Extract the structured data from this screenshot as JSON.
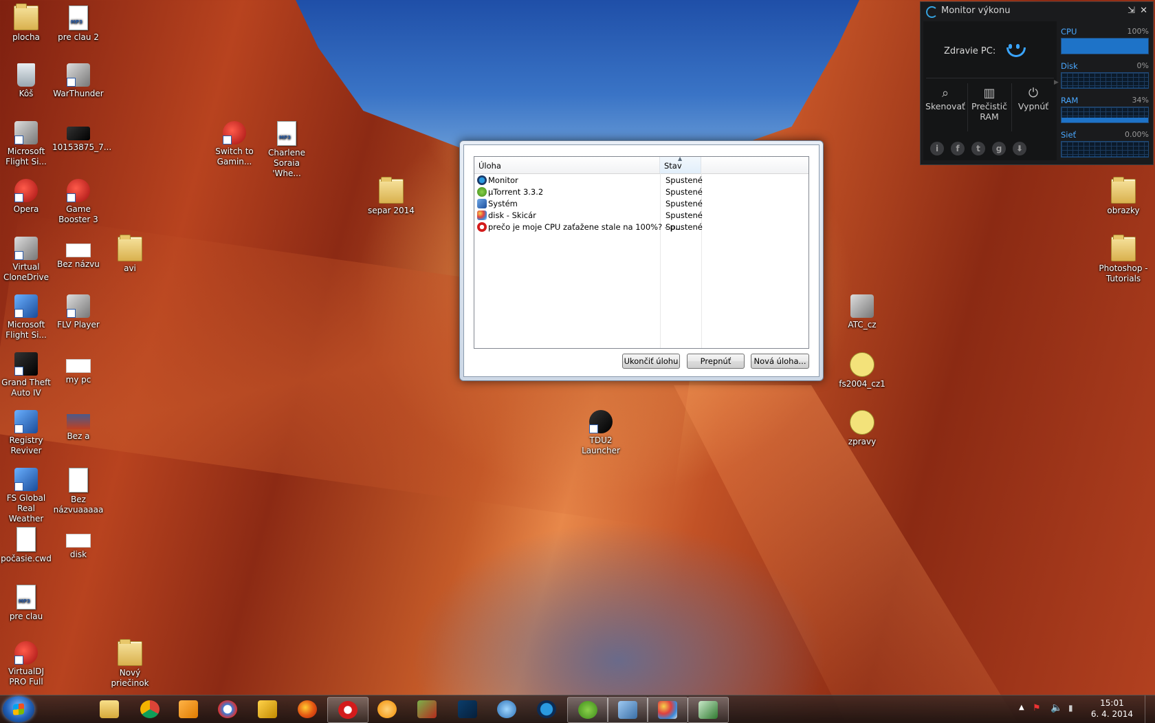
{
  "desktop": {
    "icons": [
      {
        "label": "plocha"
      },
      {
        "label": "pre clau 2"
      },
      {
        "label": "Kôš"
      },
      {
        "label": "WarThunder"
      },
      {
        "label": "Microsoft Flight Si..."
      },
      {
        "label": "10153875_7..."
      },
      {
        "label": "Switch to Gamin..."
      },
      {
        "label": "Charlene Soraia 'Whe..."
      },
      {
        "label": "Opera"
      },
      {
        "label": "Game Booster 3"
      },
      {
        "label": "separ 2014"
      },
      {
        "label": "Virtual CloneDrive"
      },
      {
        "label": "Bez názvu"
      },
      {
        "label": "avi"
      },
      {
        "label": "Microsoft Flight Si..."
      },
      {
        "label": "FLV Player"
      },
      {
        "label": "Grand Theft Auto IV"
      },
      {
        "label": "my pc"
      },
      {
        "label": "Registry Reviver"
      },
      {
        "label": "Bez a"
      },
      {
        "label": "TDU2 Launcher"
      },
      {
        "label": "FS Global Real Weather"
      },
      {
        "label": "Bez názvuaaaaa"
      },
      {
        "label": "počasie.cwd"
      },
      {
        "label": "disk"
      },
      {
        "label": "pre clau"
      },
      {
        "label": "VirtualDJ PRO Full"
      },
      {
        "label": "Nový priečinok"
      },
      {
        "label": "obrazky"
      },
      {
        "label": "Photoshop - Tutorials"
      },
      {
        "label": "ATC_cz"
      },
      {
        "label": "fs2004_cz1"
      },
      {
        "label": "zpravy"
      }
    ]
  },
  "task_dialog": {
    "columns": {
      "task": "Úloha",
      "status": "Stav"
    },
    "rows": [
      {
        "name": "Monitor",
        "status": "Spustené",
        "icon": "monitor-app-icon"
      },
      {
        "name": "µTorrent 3.3.2",
        "status": "Spustené",
        "icon": "utorrent-icon"
      },
      {
        "name": "Systém",
        "status": "Spustené",
        "icon": "system-icon"
      },
      {
        "name": "disk - Skicár",
        "status": "Spustené",
        "icon": "paint-icon"
      },
      {
        "name": "prečo je moje CPU zaťažene stale na 100%? - p...",
        "status": "Spustené",
        "icon": "opera-icon"
      }
    ],
    "buttons": {
      "end": "Ukončiť úlohu",
      "switch": "Prepnúť",
      "new": "Nová úloha..."
    }
  },
  "monitor": {
    "title": "Monitor výkonu",
    "health_label": "Zdravie PC:",
    "tools": [
      {
        "label": "Skenovať",
        "icon": "search-icon"
      },
      {
        "label": "Prečistič RAM",
        "icon": "ram-icon"
      },
      {
        "label": "Vypnúť",
        "icon": "power-icon"
      }
    ],
    "meters": [
      {
        "label": "CPU",
        "value": "100%",
        "fill": 1.0
      },
      {
        "label": "Disk",
        "value": "0%",
        "fill": 0.0
      },
      {
        "label": "RAM",
        "value": "34%",
        "fill": 0.34
      },
      {
        "label": "Sieť",
        "value": "0.00%",
        "fill": 0.0
      }
    ],
    "accent": "#1e73c8"
  },
  "taskbar": {
    "apps": [
      "explorer",
      "chrome",
      "media-player",
      "thunderbird",
      "game-booster",
      "firefox",
      "opera",
      "orange-app",
      "farming-sim",
      "photoshop",
      "mozilla",
      "monitor-app",
      "utorrent",
      "control-panel",
      "paint",
      "task-manager"
    ],
    "clock": {
      "time": "15:01",
      "date": "6. 4. 2014"
    }
  }
}
